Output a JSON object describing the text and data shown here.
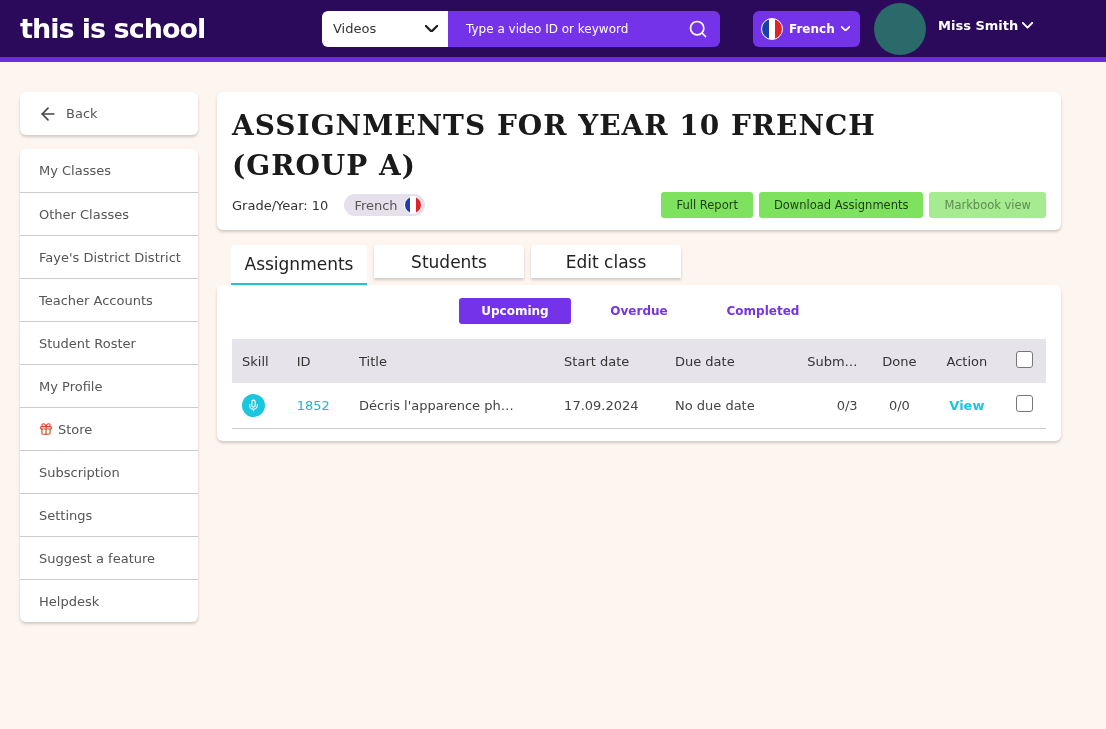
{
  "header": {
    "logo": "this is school",
    "search_type": "Videos",
    "search": {
      "placeholder": "Type a video ID or keyword"
    },
    "language": "French",
    "user": "Miss Smith"
  },
  "sidebar": {
    "back": "Back",
    "items": [
      {
        "label": "My Classes",
        "kind": "plain"
      },
      {
        "label": "Other Classes",
        "kind": "plain"
      },
      {
        "label": "Faye's District District",
        "kind": "plain"
      },
      {
        "label": "Teacher Accounts",
        "kind": "plain"
      },
      {
        "label": "Student Roster",
        "kind": "plain"
      },
      {
        "label": "My Profile",
        "kind": "plain"
      },
      {
        "label": "Store",
        "kind": "gift"
      },
      {
        "label": "Subscription",
        "kind": "plain"
      },
      {
        "label": "Settings",
        "kind": "plain"
      },
      {
        "label": "Suggest a feature",
        "kind": "plain"
      },
      {
        "label": "Helpdesk",
        "kind": "plain"
      }
    ]
  },
  "class_card": {
    "title": "ASSIGNMENTS FOR YEAR 10 FRENCH (GROUP A)",
    "grade_label": "Grade/Year:",
    "grade": "10",
    "language": "French",
    "buttons": [
      {
        "label": "Full Report",
        "disabled": false
      },
      {
        "label": "Download Assignments",
        "disabled": false
      },
      {
        "label": "Markbook view",
        "disabled": true
      }
    ]
  },
  "tabs": [
    {
      "label": "Assignments",
      "selected": true
    },
    {
      "label": "Students",
      "selected": false
    },
    {
      "label": "Edit class",
      "selected": false
    }
  ],
  "filters": [
    {
      "label": "Upcoming",
      "selected": true
    },
    {
      "label": "Overdue",
      "selected": false
    },
    {
      "label": "Completed",
      "selected": false
    }
  ],
  "table": {
    "columns": [
      "Skill",
      "ID",
      "Title",
      "Start date",
      "Due date",
      "Subm…",
      "Done",
      "Action"
    ],
    "header_checked": false,
    "rows": [
      {
        "id": "1852",
        "title": "Décris l'apparence ph…",
        "start": "17.09.2024",
        "due": "No due date",
        "submitted": "0/3",
        "done": "0/0",
        "action": "View",
        "checked": false
      }
    ]
  }
}
